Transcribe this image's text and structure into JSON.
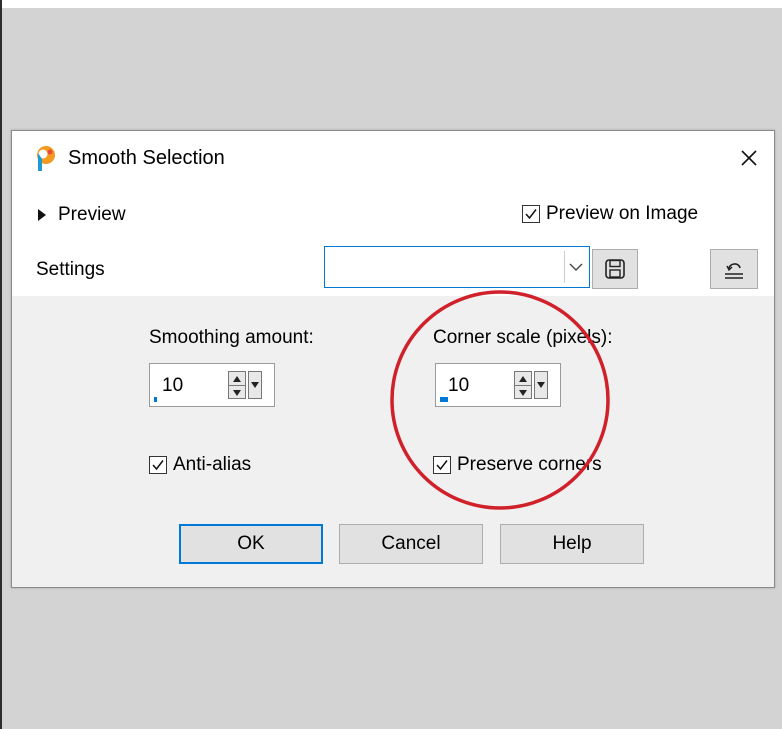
{
  "dialog": {
    "title": "Smooth Selection",
    "preview_label": "Preview",
    "preview_on_image_label": "Preview on Image",
    "preview_on_image_checked": true,
    "settings_label": "Settings",
    "settings_value": ""
  },
  "fields": {
    "smoothing_label": "Smoothing amount:",
    "smoothing_value": "10",
    "corner_label": "Corner scale (pixels):",
    "corner_value": "10",
    "anti_alias_label": "Anti-alias",
    "anti_alias_checked": true,
    "preserve_label": "Preserve corners",
    "preserve_checked": true
  },
  "buttons": {
    "ok": "OK",
    "cancel": "Cancel",
    "help": "Help"
  },
  "icons": {
    "app": "paintshop-app-icon",
    "close": "close-icon",
    "preview_expand": "triangle-right-icon",
    "settings_dropdown": "chevron-down-icon",
    "save_preset": "floppy-disk-icon",
    "reset": "reset-icon"
  },
  "colors": {
    "accent": "#0078d7",
    "annotation": "#d0202a",
    "dialog_bg": "#f0f0f0"
  }
}
